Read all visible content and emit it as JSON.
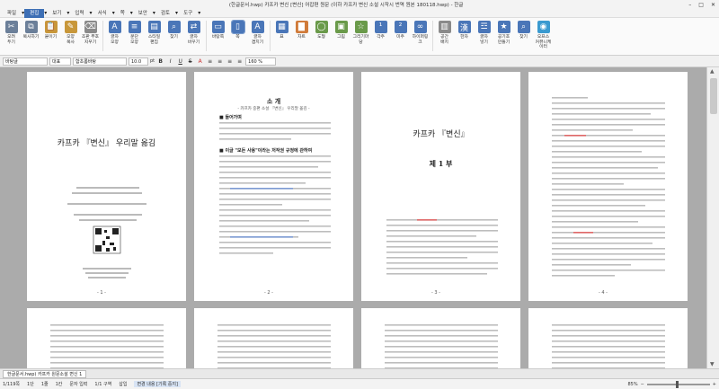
{
  "window": {
    "title": "(한글문서.hwp) 카프카 변신 [변신] 어잡편 원문 (이하 카프카 변신 소설 시작시 번역 원본 180118.hwp) - 한글",
    "controls": [
      "–",
      "□",
      "✕"
    ]
  },
  "menubar": {
    "items": [
      {
        "label": "파일",
        "caret": "▾"
      },
      {
        "label": "편집",
        "caret": "▾"
      },
      {
        "label": "보기",
        "caret": "▾"
      },
      {
        "label": "입력",
        "caret": "▾"
      },
      {
        "label": "서식",
        "caret": "▾"
      },
      {
        "label": "쪽",
        "caret": "▾"
      },
      {
        "label": "보안",
        "caret": "▾"
      },
      {
        "label": "검토",
        "caret": "▾"
      },
      {
        "label": "도구",
        "caret": "▾"
      }
    ],
    "active_index": 1
  },
  "ribbon": {
    "buttons": [
      {
        "label": "오려\n두기",
        "icon": "✂",
        "color": "#6b7f99"
      },
      {
        "label": "복사하기",
        "icon": "⧉",
        "color": "#6b7f99"
      },
      {
        "label": "붙이기",
        "icon": "📋",
        "color": "#c8973a"
      },
      {
        "label": "모양\n복사",
        "icon": "✎",
        "color": "#c8973a"
      },
      {
        "label": "조판 부호\n지우기",
        "icon": "⌫",
        "color": "#8a8a8a"
      },
      {
        "label": "글자\n모양",
        "icon": "A",
        "color": "#4a76b8"
      },
      {
        "label": "문단\n모양",
        "icon": "≡",
        "color": "#4a76b8"
      },
      {
        "label": "스타일\n편집",
        "icon": "▤",
        "color": "#4a76b8"
      },
      {
        "label": "찾기",
        "icon": "⌕",
        "color": "#4a76b8"
      },
      {
        "label": "글자\n바꾸기",
        "icon": "⇄",
        "color": "#4a76b8"
      },
      {
        "label": "바탕쪽",
        "icon": "▭",
        "color": "#4a76b8"
      },
      {
        "label": "쪽",
        "icon": "▯",
        "color": "#4a76b8"
      },
      {
        "label": "글자\n겹치기",
        "icon": "A",
        "color": "#4a76b8"
      },
      {
        "label": "표",
        "icon": "▦",
        "color": "#4a76b8"
      },
      {
        "label": "차트",
        "icon": "▇",
        "color": "#d07b3a"
      },
      {
        "label": "도형",
        "icon": "◯",
        "color": "#6a9a4a"
      },
      {
        "label": "그림",
        "icon": "▣",
        "color": "#6a9a4a"
      },
      {
        "label": "그리기마당",
        "icon": "☆",
        "color": "#6a9a4a"
      },
      {
        "label": "각주",
        "icon": "¹",
        "color": "#4a76b8"
      },
      {
        "label": "미주",
        "icon": "²",
        "color": "#4a76b8"
      },
      {
        "label": "하이퍼링크",
        "icon": "∞",
        "color": "#4a76b8"
      },
      {
        "label": "공간\n배치",
        "icon": "▥",
        "color": "#8a8a8a"
      },
      {
        "label": "한자",
        "icon": "漢",
        "color": "#4a76b8"
      },
      {
        "label": "글자\n넣기",
        "icon": "☲",
        "color": "#4a76b8"
      },
      {
        "label": "공기호\n만들기",
        "icon": "★",
        "color": "#4a76b8"
      },
      {
        "label": "찾기",
        "icon": "⌕",
        "color": "#4a76b8"
      },
      {
        "label": "오프스\n커뮤니케이터",
        "icon": "◉",
        "color": "#3a9ad0"
      }
    ],
    "selected_index": 11
  },
  "formatbar": {
    "style": "바탕글",
    "font_lang": "대표",
    "font": "함초롬바탕",
    "size": "10.0",
    "unit": "pt",
    "line_spacing": "160 %",
    "buttons": [
      "B",
      "I",
      "U",
      "S",
      "A"
    ]
  },
  "pages": [
    {
      "title": "카프카 『변신』 우리말 옮김",
      "type": "cover",
      "page_number": "- 1 -"
    },
    {
      "title": "소 개",
      "subtitle": "- 카프카 중편 소설 『변신』 우리말 옮김 -",
      "sections": [
        "■ 들어가며",
        "■ 이글 \"모든 사용\"이라는 저작권 규정에 관하여"
      ],
      "page_number": "- 2 -"
    },
    {
      "title": "카프카 『변신』",
      "subtitle": "제 1 부",
      "page_number": "- 3 -"
    },
    {
      "page_number": "- 4 -"
    }
  ],
  "tabs": [
    {
      "label": "한글문서.hwp) 카프카 원문소설 변신 1"
    }
  ],
  "status": {
    "page": "1/119쪽",
    "section": "1단",
    "line": "1줄",
    "column": "1칸",
    "chars": "문자 입력",
    "section_count": "1/1 구역",
    "mode": "삽입",
    "track": "변경 내용 [기록 중지]",
    "zoom": "85%"
  }
}
